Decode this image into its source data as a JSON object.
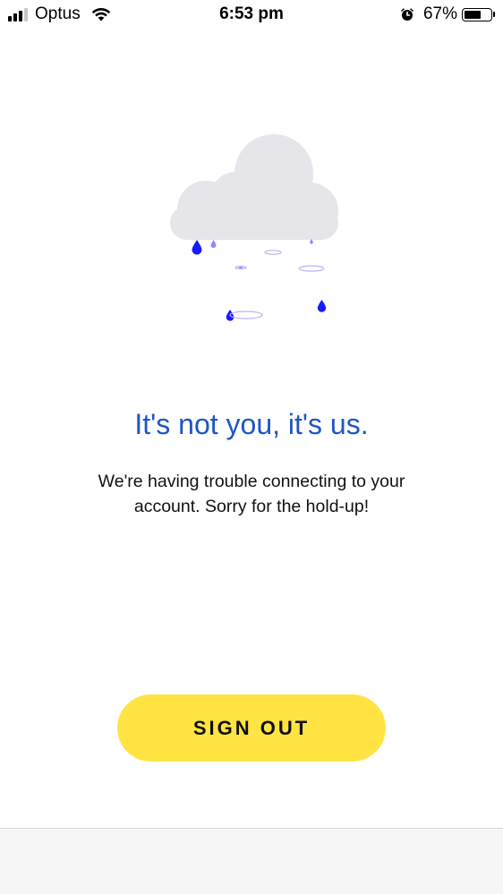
{
  "status_bar": {
    "carrier": "Optus",
    "time": "6:53 pm",
    "battery_percent_text": "67%",
    "battery_level": 0.67,
    "signal_bars_active": 3,
    "signal_bars_total": 4
  },
  "illustration": {
    "cloud_color": "#e5e5ea",
    "drop_color": "#1a1aff",
    "ripple_color": "#b9b4f5"
  },
  "error": {
    "headline": "It's not you, it's us.",
    "message": "We're having trouble connecting to your account. Sorry for the hold-up!"
  },
  "actions": {
    "sign_out_label": "SIGN OUT",
    "sign_out_color": "#ffe443"
  },
  "theme": {
    "headline_color": "#1e56c4"
  }
}
